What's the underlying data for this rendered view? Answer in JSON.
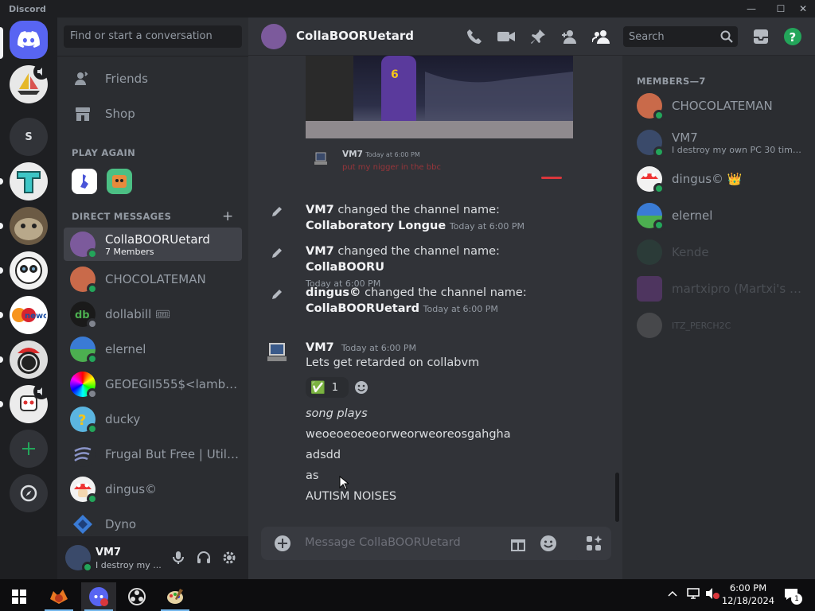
{
  "window": {
    "app_name": "Discord",
    "minimize": "—",
    "maximize": "☐",
    "close": "✕"
  },
  "sidebar": {
    "search_placeholder": "Find or start a conversation",
    "nav": [
      {
        "label": "Friends",
        "icon": "friends-icon"
      },
      {
        "label": "Shop",
        "icon": "shop-icon"
      }
    ],
    "play_again_header": "PLAY AGAIN",
    "dm_header": "DIRECT MESSAGES",
    "add_dm": "+",
    "dms": [
      {
        "name": "CollaBOORUetard",
        "sub": "7 Members",
        "selected": true,
        "status": "online"
      },
      {
        "name": "CHOCOLATEMAN",
        "status": "online"
      },
      {
        "name": "dollabill 🎟",
        "status": "offline"
      },
      {
        "name": "elernel",
        "status": "online"
      },
      {
        "name": "GEOEGII555$<lambd...",
        "status": "offline"
      },
      {
        "name": "ducky",
        "status": "online"
      },
      {
        "name": "Frugal But Free | Utilit...",
        "status": "none"
      },
      {
        "name": "dingus©",
        "status": "online"
      },
      {
        "name": "Dyno",
        "status": "none"
      }
    ]
  },
  "user_panel": {
    "username": "VM7",
    "status": "I destroy my ..."
  },
  "channel": {
    "title": "CollaBOORUetard",
    "search_placeholder": "Search"
  },
  "messages": {
    "reply": {
      "author": "VM7",
      "time": "Today at 6:00 PM",
      "text": "put my nigger in the bbc"
    },
    "system": [
      {
        "actor": "VM7",
        "action": " changed the channel name: ",
        "value": "Collaboratory Longue",
        "time": "Today at 6:00 PM"
      },
      {
        "actor": "VM7",
        "action": " changed the channel name: ",
        "value": "CollaBOORU",
        "time": "Today at 6:00 PM"
      },
      {
        "actor": "dingus©",
        "action": " changed the channel name: ",
        "value": "CollaBOORUetard",
        "time": "Today at 6:00 PM"
      }
    ],
    "group": {
      "author": "VM7",
      "time": "Today at 6:00 PM",
      "first": "Lets get retarded on collabvm",
      "reaction_emoji": "✅",
      "reaction_count": "1",
      "lines": [
        "song plays",
        "weoeoeoeoeorweorweoreosgahgha",
        "adsdd",
        "as",
        "AUTISM NOISES"
      ]
    }
  },
  "composer": {
    "placeholder": "Message CollaBOORUetard"
  },
  "members": {
    "header": "MEMBERS—7",
    "list": [
      {
        "name": "CHOCOLATEMAN",
        "status": "online"
      },
      {
        "name": "VM7",
        "sub": "I destroy my own PC 30 times ...",
        "status": "online"
      },
      {
        "name": "dingus© 👑",
        "status": "online"
      },
      {
        "name": "elernel",
        "status": "online"
      },
      {
        "name": "Kende",
        "status": "offline"
      },
      {
        "name": "martxipro (Martxi's vo...",
        "status": "offline"
      },
      {
        "name": "ITZ_PERCH2C",
        "status": "offline"
      }
    ]
  },
  "taskbar": {
    "time": "6:00 PM",
    "date": "12/18/2024",
    "notif_count": "1"
  },
  "colors": {
    "online": "#23a55a",
    "offline": "#80848e",
    "blurple": "#5865f2",
    "green": "#23a55a"
  }
}
